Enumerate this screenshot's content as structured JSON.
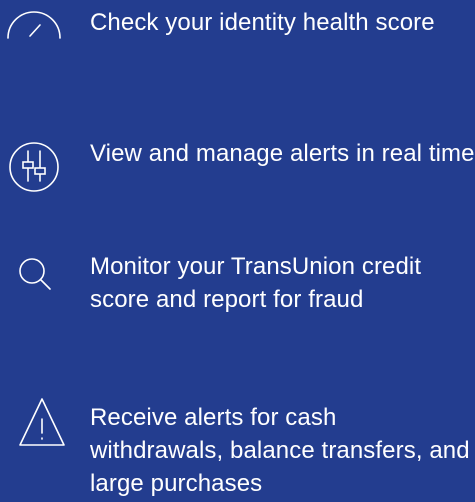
{
  "features": [
    {
      "text": "Check your identity health score",
      "icon": "gauge-icon"
    },
    {
      "text": "View and manage alerts in real time",
      "icon": "sliders-icon"
    },
    {
      "text": "Monitor your TransUnion credit score and report for fraud",
      "icon": "search-icon"
    },
    {
      "text": "Receive alerts for cash withdrawals, balance transfers, and large purchases",
      "icon": "warning-icon"
    }
  ],
  "colors": {
    "background": "#233d8f",
    "foreground": "#ffffff"
  }
}
